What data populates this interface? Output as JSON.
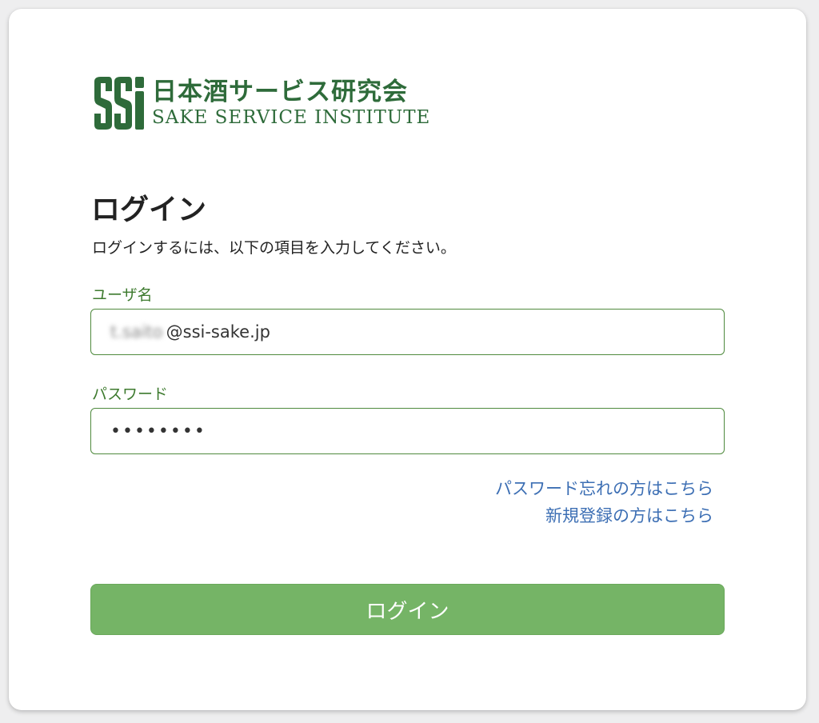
{
  "logo": {
    "mark_text": "SSI",
    "name_jp": "日本酒サービス研究会",
    "name_en": "SAKE SERVICE INSTITUTE",
    "color": "#2e6b3a"
  },
  "title": "ログイン",
  "description": "ログインするには、以下の項目を入力してください。",
  "username": {
    "label": "ユーザ名",
    "value_blurred": "t.saito",
    "value_visible": "@ssi-sake.jp"
  },
  "password": {
    "label": "パスワード",
    "masked_value": "••••••••"
  },
  "links": {
    "forgot_password": "パスワード忘れの方はこちら",
    "register": "新規登録の方はこちら"
  },
  "login_button": "ログイン",
  "colors": {
    "accent_green": "#75b466",
    "label_green": "#3d7a2e",
    "link_blue": "#3d6fb4"
  }
}
